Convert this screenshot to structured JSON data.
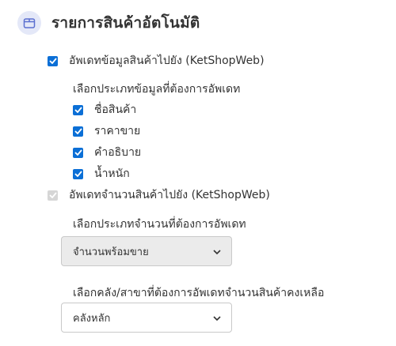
{
  "header": {
    "title": "รายการสินค้าอัตโนมัติ",
    "icon": "box-icon",
    "icon_bg": "#e4e8f8"
  },
  "update_info": {
    "label": "อัพเดทข้อมูลสินค้าไปยัง (KetShopWeb)",
    "checked": true
  },
  "info_types": {
    "label": "เลือกประเภทข้อมูลที่ต้องการอัพเดท",
    "items": [
      {
        "label": "ชื่อสินค้า",
        "checked": true
      },
      {
        "label": "ราคาขาย",
        "checked": true
      },
      {
        "label": "คำอธิบาย",
        "checked": true
      },
      {
        "label": "น้ำหนัก",
        "checked": true
      }
    ]
  },
  "update_stock": {
    "label": "อัพเดทจำนวนสินค้าไปยัง (KetShopWeb)",
    "checked": true,
    "disabled": true
  },
  "stock_type": {
    "label": "เลือกประเภทจำนวนที่ต้องการอัพเดท",
    "value": "จำนวนพร้อมขาย",
    "disabled": true
  },
  "warehouse": {
    "label": "เลือกคลัง/สาขาที่ต้องการอัพเดทจำนวนสินค้าคงเหลือ",
    "value": "คลังหลัก"
  },
  "colors": {
    "accent": "#0b6fd6",
    "disabled": "#d6d6d6"
  }
}
